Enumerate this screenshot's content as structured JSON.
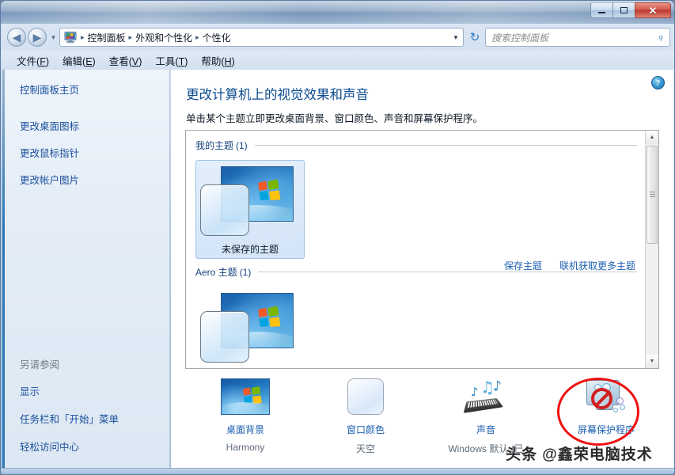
{
  "window": {
    "title": "",
    "caption_buttons": [
      {
        "name": "minimize",
        "glyph": ""
      },
      {
        "name": "maximize",
        "glyph": ""
      },
      {
        "name": "close",
        "glyph": "✕"
      }
    ]
  },
  "navigation": {
    "back_arrow": "◀",
    "forward_arrow": "▶",
    "recent_dropdown": "▼",
    "refresh": "↻",
    "address_chevron": "▼",
    "separator": "▸",
    "breadcrumbs": [
      {
        "label": "控制面板"
      },
      {
        "label": "外观和个性化"
      },
      {
        "label": "个性化"
      }
    ]
  },
  "search": {
    "placeholder": "搜索控制面板",
    "icon": "search-icon",
    "glyph": "⌕"
  },
  "menubar": {
    "items": [
      {
        "label": "文件",
        "accel": "F"
      },
      {
        "label": "编辑",
        "accel": "E"
      },
      {
        "label": "查看",
        "accel": "V"
      },
      {
        "label": "工具",
        "accel": "T"
      },
      {
        "label": "帮助",
        "accel": "H"
      }
    ]
  },
  "sidebar": {
    "home": "控制面板主页",
    "items": [
      {
        "label": "更改桌面图标"
      },
      {
        "label": "更改鼠标指针"
      },
      {
        "label": "更改帐户图片"
      }
    ],
    "see_also_title": "另请参阅",
    "see_also": [
      {
        "label": "显示"
      },
      {
        "label": "任务栏和「开始」菜单"
      },
      {
        "label": "轻松访问中心"
      }
    ]
  },
  "main": {
    "help_glyph": "?",
    "title": "更改计算机上的视觉效果和声音",
    "subtitle": "单击某个主题立即更改桌面背景、窗口颜色、声音和屏幕保护程序。",
    "groups": [
      {
        "label": "我的主题",
        "count": "(1)",
        "themes": [
          {
            "name": "未保存的主题",
            "selected": true
          }
        ]
      },
      {
        "label": "Aero 主题",
        "count": "(1)",
        "themes": [
          {
            "name": "",
            "selected": false
          }
        ]
      }
    ],
    "links": [
      {
        "label": "保存主题"
      },
      {
        "label": "联机获取更多主题"
      }
    ],
    "scrollbar": {
      "up_glyph": "▲",
      "down_glyph": "▼"
    }
  },
  "tasks": [
    {
      "icon": "desktop-background-icon",
      "label": "桌面背景",
      "value": "Harmony"
    },
    {
      "icon": "window-color-icon",
      "label": "窗口颜色",
      "value": "天空"
    },
    {
      "icon": "sound-icon",
      "label": "声音",
      "value": "Windows 默认 (已"
    },
    {
      "icon": "screen-saver-icon",
      "label": "屏幕保护程序",
      "value": ""
    }
  ],
  "annotation": {
    "shape": "ellipse",
    "color": "#ee1111",
    "targets": "screen-saver-icon"
  },
  "watermark": {
    "text": "头条 @鑫荣电脑技术"
  },
  "colors": {
    "link": "#1b5fb0",
    "heading": "#0d4c8f",
    "annotation_red": "#ee1111",
    "titlebar_blue": "#7e9bbd",
    "close_red": "#bb3a2d"
  }
}
